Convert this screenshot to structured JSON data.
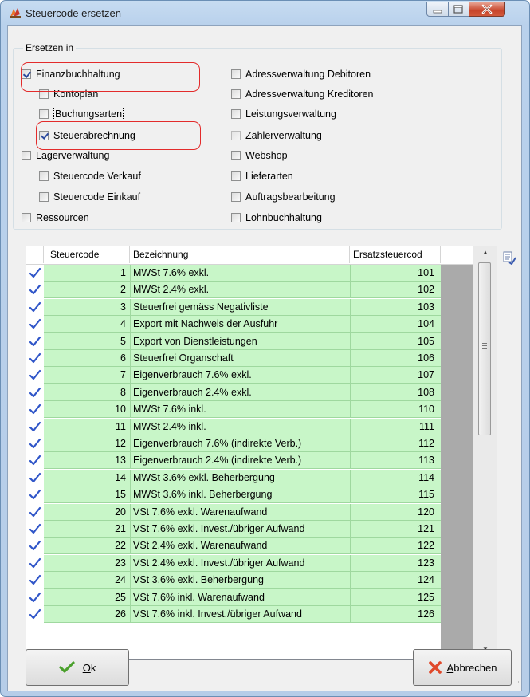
{
  "window": {
    "title": "Steuercode ersetzen"
  },
  "group": {
    "legend": "Ersetzen in",
    "left": [
      {
        "label": "Finanzbuchhaltung",
        "checked": true
      },
      {
        "label": "Kontoplan",
        "checked": false
      },
      {
        "label": "Buchungsarten",
        "checked": false
      },
      {
        "label": "Steuerabrechnung",
        "checked": true
      },
      {
        "label": "Lagerverwaltung",
        "checked": false
      },
      {
        "label": "Steuercode Verkauf",
        "checked": false
      },
      {
        "label": "Steuercode Einkauf",
        "checked": false
      },
      {
        "label": "Ressourcen",
        "checked": false
      }
    ],
    "right": [
      {
        "label": "Adressverwaltung Debitoren",
        "checked": false
      },
      {
        "label": "Adressverwaltung Kreditoren",
        "checked": false
      },
      {
        "label": "Leistungsverwaltung",
        "checked": false
      },
      {
        "label": "Zählerverwaltung",
        "checked": false
      },
      {
        "label": "Webshop",
        "checked": false
      },
      {
        "label": "Lieferarten",
        "checked": false
      },
      {
        "label": "Auftragsbearbeitung",
        "checked": false
      },
      {
        "label": "Lohnbuchhaltung",
        "checked": false
      }
    ]
  },
  "grid": {
    "columns": [
      "Steuercode",
      "Bezeichnung",
      "Ersatzsteuercod"
    ],
    "rows": [
      [
        "1",
        "MWSt 7.6% exkl.",
        "101"
      ],
      [
        "2",
        "MWSt 2.4% exkl.",
        "102"
      ],
      [
        "3",
        "Steuerfrei gemäss Negativliste",
        "103"
      ],
      [
        "4",
        "Export mit Nachweis der Ausfuhr",
        "104"
      ],
      [
        "5",
        "Export von Dienstleistungen",
        "105"
      ],
      [
        "6",
        "Steuerfrei Organschaft",
        "106"
      ],
      [
        "7",
        "Eigenverbrauch 7.6% exkl.",
        "107"
      ],
      [
        "8",
        "Eigenverbrauch 2.4% exkl.",
        "108"
      ],
      [
        "10",
        "MWSt 7.6% inkl.",
        "110"
      ],
      [
        "11",
        "MWSt 2.4% inkl.",
        "111"
      ],
      [
        "12",
        "Eigenverbrauch 7.6% (indirekte Verb.)",
        "112"
      ],
      [
        "13",
        "Eigenverbrauch 2.4% (indirekte Verb.)",
        "113"
      ],
      [
        "14",
        "MWSt 3.6% exkl. Beherbergung",
        "114"
      ],
      [
        "15",
        "MWSt 3.6% inkl. Beherbergung",
        "115"
      ],
      [
        "20",
        "VSt 7.6% exkl. Warenaufwand",
        "120"
      ],
      [
        "21",
        "VSt 7.6% exkl. Invest./übriger Aufwand",
        "121"
      ],
      [
        "22",
        "VSt 2.4% exkl. Warenaufwand",
        "122"
      ],
      [
        "23",
        "VSt 2.4% exkl. Invest./übriger Aufwand",
        "123"
      ],
      [
        "24",
        "VSt 3.6% exkl. Beherbergung",
        "124"
      ],
      [
        "25",
        "VSt 7.6% inkl. Warenaufwand",
        "125"
      ],
      [
        "26",
        "VSt 7.6% inkl. Invest./übriger Aufwand",
        "126"
      ]
    ]
  },
  "buttons": {
    "ok_mnemonic": "O",
    "ok_rest": "k",
    "cancel_mnemonic": "A",
    "cancel_rest": "bbrechen"
  },
  "colors": {
    "row_green": "#c8f6c8",
    "highlight_red": "#e32b2b"
  }
}
